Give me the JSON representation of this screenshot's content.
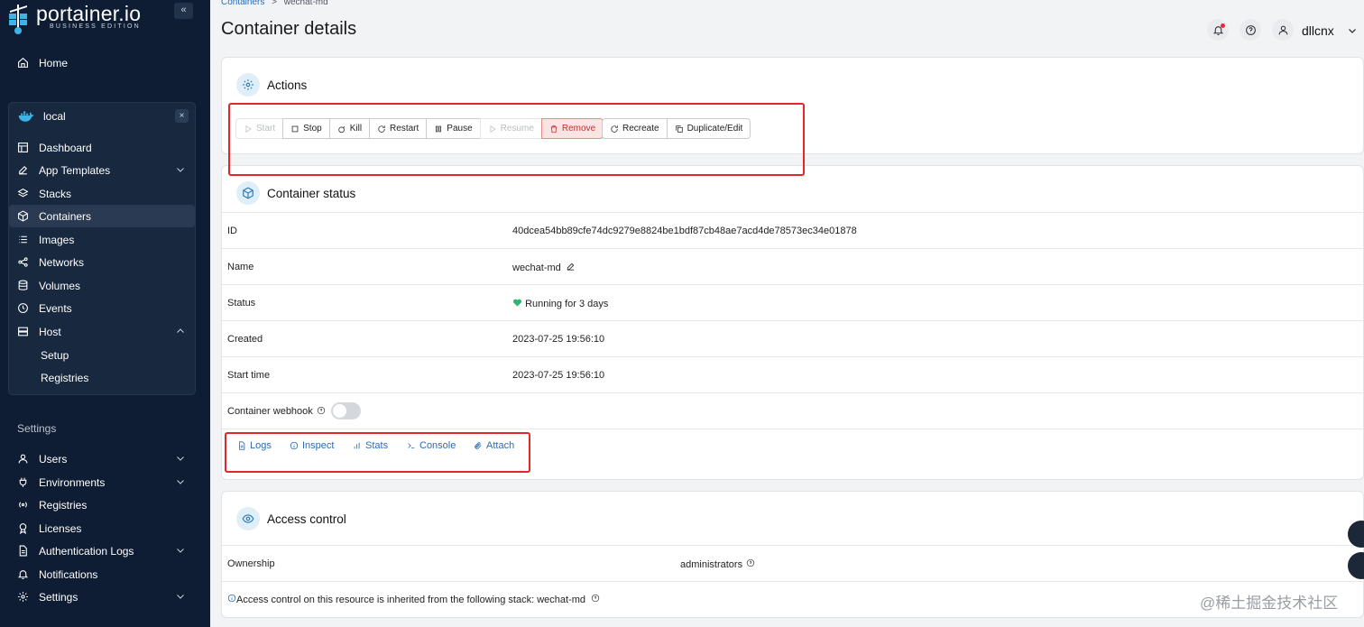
{
  "sidebar": {
    "logo_word": "portainer.io",
    "logo_sub": "BUSINESS EDITION",
    "collapse": "«",
    "home": "Home",
    "env_name": "local",
    "env_close": "×",
    "items": [
      {
        "label": "Dashboard",
        "icon": "dashboard-icon"
      },
      {
        "label": "App Templates",
        "icon": "edit-icon"
      },
      {
        "label": "Stacks",
        "icon": "layers-icon"
      },
      {
        "label": "Containers",
        "icon": "box-icon"
      },
      {
        "label": "Images",
        "icon": "list-icon"
      },
      {
        "label": "Networks",
        "icon": "share-icon"
      },
      {
        "label": "Volumes",
        "icon": "database-icon"
      },
      {
        "label": "Events",
        "icon": "clock-icon"
      },
      {
        "label": "Host",
        "icon": "server-icon"
      }
    ],
    "host_sub": [
      "Setup",
      "Registries"
    ],
    "settings_label": "Settings",
    "settings_items": [
      {
        "label": "Users",
        "icon": "user-icon"
      },
      {
        "label": "Environments",
        "icon": "plug-icon"
      },
      {
        "label": "Registries",
        "icon": "radio-icon"
      },
      {
        "label": "Licenses",
        "icon": "award-icon"
      },
      {
        "label": "Authentication Logs",
        "icon": "log-icon"
      },
      {
        "label": "Notifications",
        "icon": "bell-icon"
      },
      {
        "label": "Settings",
        "icon": "gear-icon"
      }
    ]
  },
  "header": {
    "breadcrumb_root": "Containers",
    "breadcrumb_sep": ">",
    "breadcrumb_current": "wechat-md",
    "title": "Container details",
    "user": "dllcnx"
  },
  "actions": {
    "title": "Actions",
    "buttons": [
      "Start",
      "Stop",
      "Kill",
      "Restart",
      "Pause",
      "Resume",
      "Remove"
    ],
    "buttons2": [
      "Recreate",
      "Duplicate/Edit"
    ]
  },
  "status": {
    "title": "Container status",
    "rows": [
      {
        "key": "ID",
        "value": "40dcea54bb89cfe74dc9279e8824be1bdf87cb48ae7acd4de78573ec34e01878"
      },
      {
        "key": "Name",
        "value": "wechat-md"
      },
      {
        "key": "Status",
        "value": "Running for 3 days"
      },
      {
        "key": "Created",
        "value": "2023-07-25 19:56:10"
      },
      {
        "key": "Start time",
        "value": "2023-07-25 19:56:10"
      }
    ],
    "webhook_label": "Container webhook",
    "links": [
      "Logs",
      "Inspect",
      "Stats",
      "Console",
      "Attach"
    ]
  },
  "access": {
    "title": "Access control",
    "ownership_key": "Ownership",
    "ownership_value": "administrators",
    "note": "Access control on this resource is inherited from the following stack: wechat-md"
  },
  "watermark": "@稀土掘金技术社区"
}
